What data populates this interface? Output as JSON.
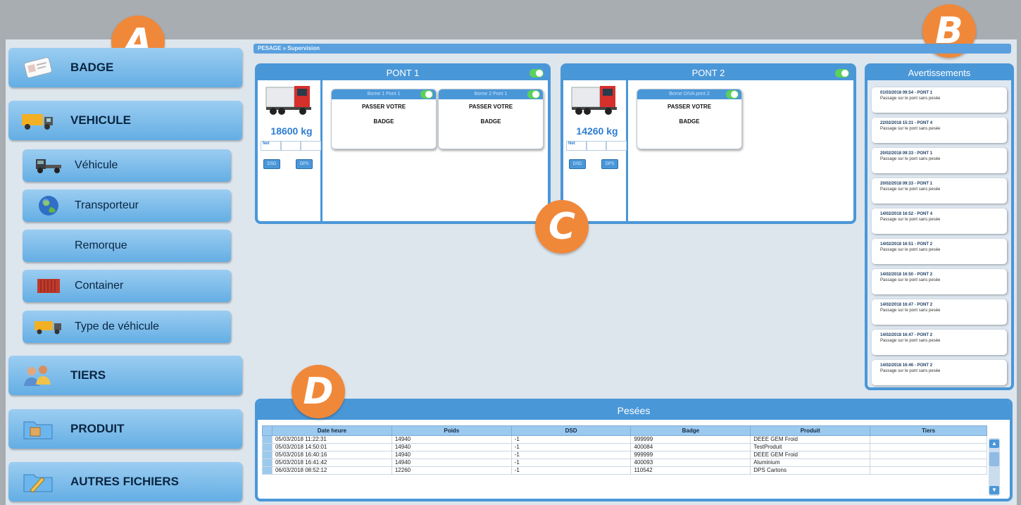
{
  "callouts": [
    "A",
    "B",
    "C",
    "D"
  ],
  "breadcrumb": {
    "root": "PESAGE",
    "separator": "»",
    "current": "Supervision"
  },
  "sidebar": {
    "badge": {
      "label": "BADGE",
      "icon": "badge-card-icon"
    },
    "vehicule": {
      "label": "VEHICULE",
      "icon": "truck-icon"
    },
    "sub_items": [
      {
        "label": "Véhicule",
        "icon": "tractor-icon"
      },
      {
        "label": "Transporteur",
        "icon": "globe-icon"
      },
      {
        "label": "Remorque",
        "icon": ""
      },
      {
        "label": "Container",
        "icon": "container-icon"
      },
      {
        "label": "Type de véhicule",
        "icon": "truck-icon"
      }
    ],
    "tiers": {
      "label": "TIERS",
      "icon": "users-icon"
    },
    "produit": {
      "label": "PRODUIT",
      "icon": "folder-box-icon"
    },
    "autres": {
      "label": "AUTRES FICHIERS",
      "icon": "folder-pencil-icon"
    }
  },
  "ponts": [
    {
      "title": "PONT 1",
      "enabled": true,
      "weight": "18600 kg",
      "net_label": "Net",
      "btn1": "DSD",
      "btn2": "DPS",
      "bornes": [
        {
          "title": "Borne 1 Pont 1",
          "line1": "PASSER VOTRE",
          "line2": "BADGE"
        },
        {
          "title": "Borne 2 Pont 1",
          "line1": "PASSER VOTRE",
          "line2": "BADGE"
        }
      ]
    },
    {
      "title": "PONT 2",
      "enabled": true,
      "weight": "14260 kg",
      "net_label": "Net",
      "btn1": "DSD",
      "btn2": "DPS",
      "bornes": [
        {
          "title": "Borne DIVA pont 2",
          "line1": "PASSER VOTRE",
          "line2": "BADGE"
        }
      ]
    }
  ],
  "avertissements": {
    "title": "Avertissements",
    "items": [
      {
        "date": "01/03/2018 09:54 - PONT 1",
        "message": "Passage sur le pont sans pesée"
      },
      {
        "date": "22/02/2018 15:31 - PONT 4",
        "message": "Passage sur le pont sans pesée"
      },
      {
        "date": "20/02/2018 09:33 - PONT 1",
        "message": "Passage sur le pont sans pesée"
      },
      {
        "date": "20/02/2018 09:33 - PONT 1",
        "message": "Passage sur le pont sans pesée"
      },
      {
        "date": "14/02/2018 16:52 - PONT 4",
        "message": "Passage sur le pont sans pesée"
      },
      {
        "date": "14/02/2018 16:51 - PONT 2",
        "message": "Passage sur le pont sans pesée"
      },
      {
        "date": "14/02/2018 16:50 - PONT 2",
        "message": "Passage sur le pont sans pesée"
      },
      {
        "date": "14/02/2018 16:47 - PONT 2",
        "message": "Passage sur le pont sans pesée"
      },
      {
        "date": "14/02/2018 16:47 - PONT 2",
        "message": "Passage sur le pont sans pesée"
      },
      {
        "date": "14/02/2018 16:46 - PONT 2",
        "message": "Passage sur le pont sans pesée"
      }
    ]
  },
  "pesees": {
    "title": "Pesées",
    "columns": [
      "Date heure",
      "Poids",
      "DSD",
      "Badge",
      "Produit",
      "Tiers"
    ],
    "rows": [
      [
        "05/03/2018 11:22:31",
        "14940",
        "-1",
        "999999",
        "DEEE GEM Froid",
        ""
      ],
      [
        "05/03/2018 14:50:01",
        "14940",
        "-1",
        "400084",
        "TestProduit",
        ""
      ],
      [
        "05/03/2018 16:40:16",
        "14940",
        "-1",
        "999999",
        "DEEE GEM Froid",
        ""
      ],
      [
        "05/03/2018 16:41:42",
        "14940",
        "-1",
        "400093",
        "Aluminium",
        ""
      ],
      [
        "06/03/2018 08:52:12",
        "12260",
        "-1",
        "110542",
        "DPS Cartons",
        ""
      ]
    ]
  }
}
